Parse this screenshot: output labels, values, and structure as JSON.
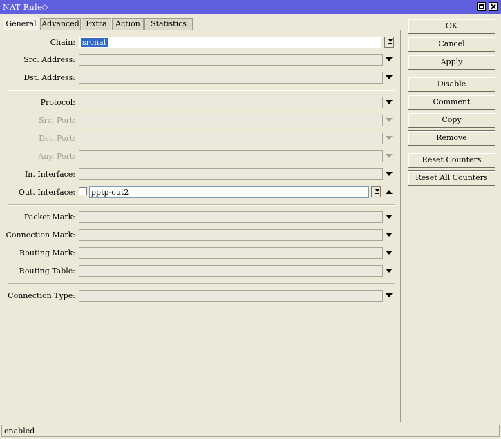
{
  "window": {
    "title": "NAT Rule"
  },
  "tabs": [
    {
      "label": "General"
    },
    {
      "label": "Advanced"
    },
    {
      "label": "Extra"
    },
    {
      "label": "Action"
    },
    {
      "label": "Statistics"
    }
  ],
  "fields": {
    "chain": {
      "label": "Chain:",
      "value": "srcnat"
    },
    "src_address": {
      "label": "Src. Address:"
    },
    "dst_address": {
      "label": "Dst. Address:"
    },
    "protocol": {
      "label": "Protocol:"
    },
    "src_port": {
      "label": "Src. Port:"
    },
    "dst_port": {
      "label": "Dst. Port:"
    },
    "any_port": {
      "label": "Any. Port:"
    },
    "in_interface": {
      "label": "In. Interface:"
    },
    "out_interface": {
      "label": "Out. Interface:",
      "value": "pptp-out2"
    },
    "packet_mark": {
      "label": "Packet Mark:"
    },
    "connection_mark": {
      "label": "Connection Mark:"
    },
    "routing_mark": {
      "label": "Routing Mark:"
    },
    "routing_table": {
      "label": "Routing Table:"
    },
    "connection_type": {
      "label": "Connection Type:"
    }
  },
  "buttons": {
    "ok": "OK",
    "cancel": "Cancel",
    "apply": "Apply",
    "disable": "Disable",
    "comment": "Comment",
    "copy": "Copy",
    "remove": "Remove",
    "reset_counters": "Reset Counters",
    "reset_all_counters": "Reset All Counters"
  },
  "status": "enabled",
  "colors": {
    "titlebar": "#5f5fe0",
    "selection": "#316ac5",
    "background": "#ece9d8"
  }
}
